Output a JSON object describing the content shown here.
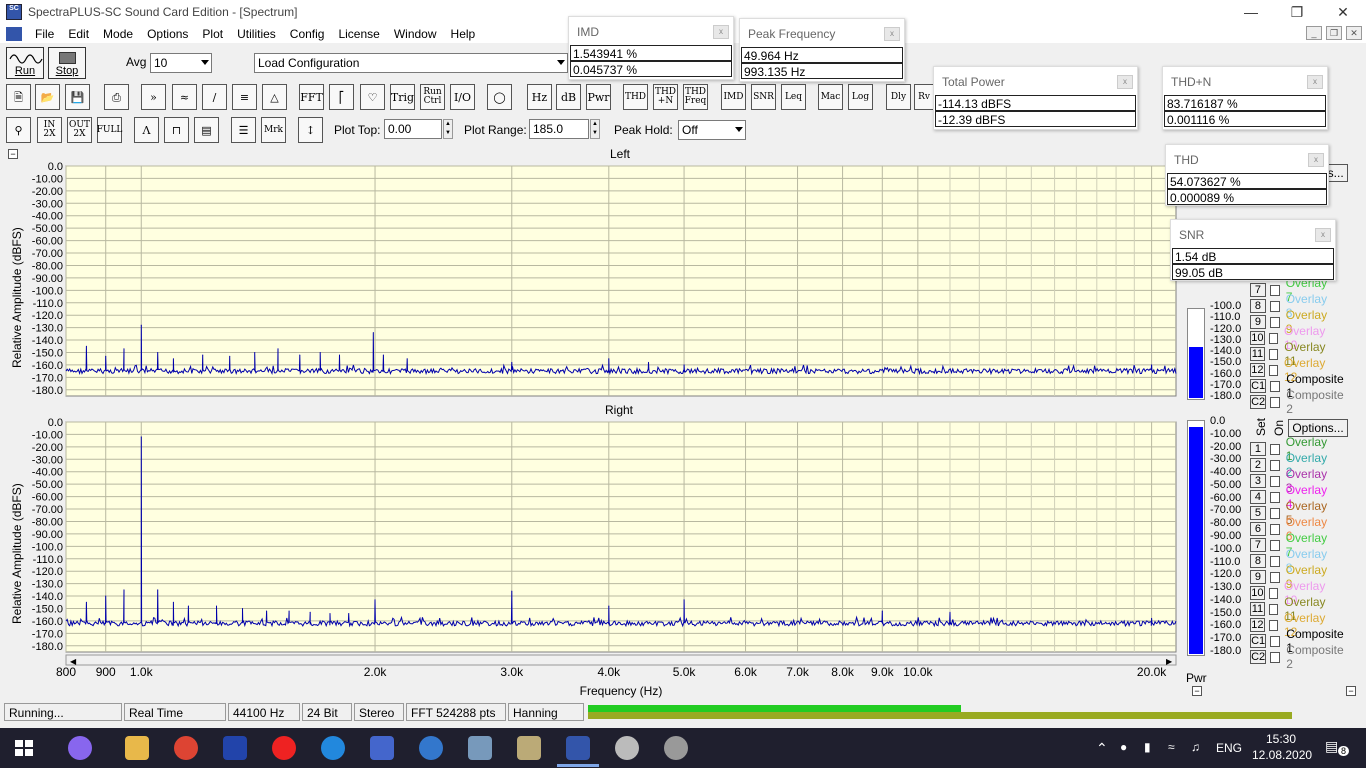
{
  "window": {
    "title": "SpectraPLUS-SC Sound Card Edition - [Spectrum]",
    "icon_text": "SC"
  },
  "menu": [
    "File",
    "Edit",
    "Mode",
    "Options",
    "Plot",
    "Utilities",
    "Config",
    "License",
    "Window",
    "Help"
  ],
  "toolbar1": {
    "run_label": "Run",
    "stop_label": "Stop",
    "avg_label": "Avg",
    "avg_value": "10",
    "config_value": "Load Configuration"
  },
  "toolbar2_buttons": [
    "FFT",
    "Trig",
    "Run Ctrl",
    "I/O",
    "Hz",
    "dB",
    "Pwr",
    "THD",
    "THD +N",
    "THD Freq",
    "IMD",
    "SNR",
    "Leq",
    "Mac",
    "Log",
    "Dly",
    "Rv"
  ],
  "toolbar3": {
    "plot_top_label": "Plot Top:",
    "plot_top_value": "0.00",
    "plot_range_label": "Plot Range:",
    "plot_range_value": "185.0",
    "peak_hold_label": "Peak Hold:",
    "peak_hold_value": "Off",
    "mrk_label": "Mrk"
  },
  "meters": {
    "imd": {
      "title": "IMD",
      "v1": "1.543941 %",
      "v2": "0.045737 %"
    },
    "peak": {
      "title": "Peak Frequency",
      "v1": "49.964 Hz",
      "v2": "993.135 Hz"
    },
    "power": {
      "title": "Total Power",
      "v1": "-114.13 dBFS",
      "v2": "-12.39 dBFS"
    },
    "thdn": {
      "title": "THD+N",
      "v1": "83.716187 %",
      "v2": "0.001116 %"
    },
    "thd": {
      "title": "THD",
      "v1": "54.073627 %",
      "v2": "0.000089 %"
    },
    "snr": {
      "title": "SNR",
      "v1": " 1.54 dB",
      "v2": "99.05 dB"
    }
  },
  "plot": {
    "left_title": "Left",
    "right_title": "Right",
    "ylabel": "Relative Amplitude (dBFS)",
    "xlabel": "Frequency (Hz)",
    "pwr_label": "Pwr",
    "set_label": "Set",
    "on_label": "On",
    "options_label": "Options..."
  },
  "overlays": [
    "Overlay 1",
    "Overlay 2",
    "Overlay 3",
    "Overlay 4",
    "Overlay 5",
    "Overlay 6",
    "Overlay 7",
    "Overlay 8",
    "Overlay 9",
    "Overlay 10",
    "Overlay 11",
    "Overlay 12",
    "Composite 1",
    "Composite 2"
  ],
  "overlay_nums": [
    "1",
    "2",
    "3",
    "4",
    "5",
    "6",
    "7",
    "8",
    "9",
    "10",
    "11",
    "12",
    "C1",
    "C2"
  ],
  "overlay_colors": [
    "#339933",
    "#33aaaa",
    "#aa33aa",
    "#ee22ee",
    "#aa6622",
    "#ee8844",
    "#44cc44",
    "#88ccee",
    "#ccaa22",
    "#ee99ee",
    "#888822",
    "#ddaa33",
    "#000000",
    "#777777"
  ],
  "meter_scale": [
    "0.0",
    "-10.00",
    "-20.00",
    "-30.00",
    "-40.00",
    "-50.00",
    "-60.00",
    "-70.00",
    "-80.00",
    "-90.00",
    "-100.0",
    "-110.0",
    "-120.0",
    "-130.0",
    "-140.0",
    "-150.0",
    "-160.0",
    "-170.0",
    "-180.0"
  ],
  "chart_data": [
    {
      "type": "line",
      "title": "Left",
      "xlabel": "Frequency (Hz)",
      "ylabel": "Relative Amplitude (dBFS)",
      "xscale": "log",
      "xlim": [
        800,
        21500
      ],
      "ylim": [
        -185,
        0
      ],
      "xticks": [
        800,
        900,
        1000,
        2000,
        3000,
        4000,
        5000,
        6000,
        7000,
        8000,
        9000,
        10000,
        20000
      ],
      "xticklabels": [
        "800",
        "900",
        "1.0k",
        "2.0k",
        "3.0k",
        "4.0k",
        "5.0k",
        "6.0k",
        "7.0k",
        "8.0k",
        "9.0k",
        "10.0k",
        "20.0k"
      ],
      "yticklabels": [
        "0.0",
        "-10.00",
        "-20.00",
        "-30.00",
        "-40.00",
        "-50.00",
        "-60.00",
        "-70.00",
        "-80.00",
        "-90.00",
        "-100.0",
        "-110.0",
        "-120.0",
        "-130.0",
        "-140.0",
        "-150.0",
        "-160.0",
        "-170.0",
        "-180.0"
      ],
      "grid": true,
      "noise_floor": -163,
      "peaks": [
        [
          850,
          -145
        ],
        [
          900,
          -153
        ],
        [
          950,
          -147
        ],
        [
          1000,
          -128
        ],
        [
          1050,
          -150
        ],
        [
          1100,
          -155
        ],
        [
          1200,
          -152
        ],
        [
          1300,
          -153
        ],
        [
          1400,
          -150
        ],
        [
          1500,
          -147
        ],
        [
          1600,
          -152
        ],
        [
          1700,
          -150
        ],
        [
          1800,
          -152
        ],
        [
          1990,
          -134
        ],
        [
          2050,
          -152
        ],
        [
          2200,
          -155
        ],
        [
          3000,
          -158
        ],
        [
          4000,
          -155
        ],
        [
          4500,
          -158
        ],
        [
          5000,
          -160
        ],
        [
          20000,
          -160
        ]
      ]
    },
    {
      "type": "line",
      "title": "Right",
      "xlabel": "Frequency (Hz)",
      "ylabel": "Relative Amplitude (dBFS)",
      "xscale": "log",
      "xlim": [
        800,
        21500
      ],
      "ylim": [
        -185,
        0
      ],
      "xticks": [
        800,
        900,
        1000,
        2000,
        3000,
        4000,
        5000,
        6000,
        7000,
        8000,
        9000,
        10000,
        20000
      ],
      "xticklabels": [
        "800",
        "900",
        "1.0k",
        "2.0k",
        "3.0k",
        "4.0k",
        "5.0k",
        "6.0k",
        "7.0k",
        "8.0k",
        "9.0k",
        "10.0k",
        "20.0k"
      ],
      "yticklabels": [
        "0.0",
        "-10.00",
        "-20.00",
        "-30.00",
        "-40.00",
        "-50.00",
        "-60.00",
        "-70.00",
        "-80.00",
        "-90.00",
        "-100.0",
        "-110.0",
        "-120.0",
        "-130.0",
        "-140.0",
        "-150.0",
        "-160.0",
        "-170.0",
        "-180.0"
      ],
      "grid": true,
      "noise_floor": -160,
      "peaks": [
        [
          850,
          -145
        ],
        [
          900,
          -140
        ],
        [
          950,
          -135
        ],
        [
          1000,
          -12
        ],
        [
          1050,
          -135
        ],
        [
          1100,
          -145
        ],
        [
          1150,
          -148
        ],
        [
          1250,
          -148
        ],
        [
          1350,
          -150
        ],
        [
          1450,
          -152
        ],
        [
          1550,
          -152
        ],
        [
          1650,
          -153
        ],
        [
          1750,
          -154
        ],
        [
          1850,
          -154
        ],
        [
          2000,
          -143
        ],
        [
          3000,
          -136
        ],
        [
          4000,
          -148
        ],
        [
          5000,
          -143
        ],
        [
          9000,
          -152
        ],
        [
          11000,
          -153
        ],
        [
          20000,
          -158
        ]
      ]
    }
  ],
  "status": {
    "state": "Running...",
    "mode": "Real Time",
    "rate": "44100 Hz",
    "bits": "24 Bit",
    "channels": "Stereo",
    "fft": "FFT 524288 pts",
    "window": "Hanning"
  },
  "level_meter": {
    "level_1": 0.53,
    "level_2": 1.0
  },
  "pwr_meter": {
    "left_level": 0.57,
    "right_level": 0.97
  },
  "taskbar": {
    "lang": "ENG",
    "time": "15:30",
    "date": "12.08.2020",
    "notif_count": "8"
  }
}
